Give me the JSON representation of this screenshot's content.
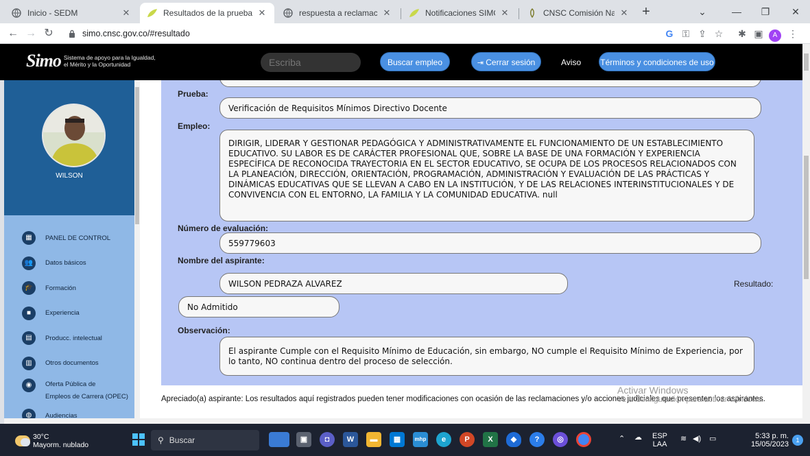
{
  "browser": {
    "tabs": [
      {
        "title": "Inicio - SEDM",
        "active": false
      },
      {
        "title": "Resultados de la prueba",
        "active": true
      },
      {
        "title": "respuesta a reclamacion SIM",
        "active": false
      },
      {
        "title": "Notificaciones SIMO",
        "active": false
      },
      {
        "title": "CNSC Comisión Nacional del",
        "active": false
      }
    ],
    "url": "simo.cnsc.gov.co/#resultado",
    "profile_initial": "A"
  },
  "header": {
    "logo_mark": "Simo",
    "logo_tagline_1": "Sistema de apoyo para la Igualdad,",
    "logo_tagline_2": "el Mérito y la Oportunidad",
    "search_placeholder": "Escriba",
    "search_button": "Buscar empleo",
    "logout_button": "Cerrar sesión",
    "notice_link": "Aviso",
    "terms_button": "Términos y condiciones de uso"
  },
  "sidebar": {
    "user_name": "WILSON",
    "items": [
      {
        "label": "PANEL DE CONTROL",
        "icon": "dashboard-icon"
      },
      {
        "label": "Datos básicos",
        "icon": "people-icon"
      },
      {
        "label": "Formación",
        "icon": "graduation-icon"
      },
      {
        "label": "Experiencia",
        "icon": "briefcase-icon"
      },
      {
        "label": "Producc. intelectual",
        "icon": "book-icon"
      },
      {
        "label": "Otros documentos",
        "icon": "document-icon"
      },
      {
        "label_1": "Oferta Pública de",
        "label_2": "Empleos de Carrera (OPEC)",
        "icon": "globe-icon"
      },
      {
        "label": "Audiencias",
        "icon": "audience-icon"
      }
    ]
  },
  "result": {
    "test_label": "Prueba:",
    "test_value": "Verificación de Requisitos Mínimos Directivo Docente",
    "job_label": "Empleo:",
    "job_value": "DIRIGIR, LIDERAR Y GESTIONAR PEDAGÓGICA Y ADMINISTRATIVAMENTE EL FUNCIONAMIENTO DE UN ESTABLECIMIENTO EDUCATIVO. SU LABOR ES DE CARÁCTER PROFESIONAL QUE, SOBRE LA BASE DE UNA FORMACIÓN Y EXPERIENCIA ESPECÍFICA DE RECONOCIDA TRAYECTORIA EN EL SECTOR EDUCATIVO, SE OCUPA DE LOS PROCESOS RELACIONADOS CON LA PLANEACIÓN, DIRECCIÓN, ORIENTACIÓN, PROGRAMACIÓN, ADMINISTRACIÓN Y EVALUACIÓN DE LAS PRÁCTICAS Y DINÁMICAS EDUCATIVAS QUE SE LLEVAN A CABO EN LA INSTITUCIÓN, Y DE LAS RELACIONES INTERINSTITUCIONALES Y DE CONVIVENCIA CON EL ENTORNO, LA FAMILIA Y LA COMUNIDAD EDUCATIVA. null",
    "eval_label": "Número de evaluación:",
    "eval_value": "559779603",
    "name_label": "Nombre del aspirante:",
    "name_value": "WILSON PEDRAZA ALVAREZ",
    "result_label": "Resultado:",
    "result_value": "No Admitido",
    "obs_label": "Observación:",
    "obs_value": "El aspirante Cumple con el Requisito Mínimo de Educación, sin embargo, NO cumple el Requisito Mínimo de Experiencia, por lo tanto, NO continua dentro del proceso de selección.",
    "notice": "Apreciado(a) aspirante: Los resultados aquí registrados pueden tener modificaciones con ocasión de las reclamaciones y/o acciones judiciales que presenten los aspirantes."
  },
  "watermark": {
    "line1": "Activar Windows",
    "line2": "Ve a Configuración para activar Windows."
  },
  "taskbar": {
    "temperature": "30°C",
    "weather": "Mayorm. nublado",
    "search": "Buscar",
    "lang_1": "ESP",
    "lang_2": "LAA",
    "time": "5:33 p. m.",
    "date": "15/05/2023",
    "notifications": "1"
  },
  "colors": {
    "panel": "#b7c6f5",
    "sidebar": "#8fb8e6",
    "profile": "#1f5f97",
    "header_button": "#4a90e2",
    "header": "#000000"
  }
}
